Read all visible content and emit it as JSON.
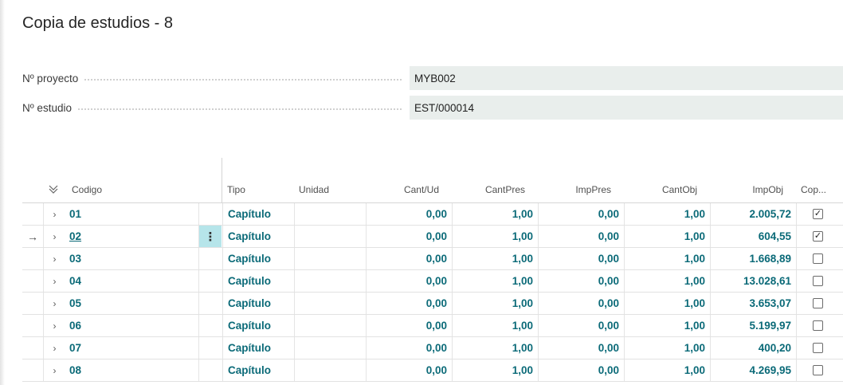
{
  "page": {
    "title": "Copia de estudios - 8"
  },
  "fields": [
    {
      "label": "Nº proyecto",
      "value": "MYB002"
    },
    {
      "label": "Nº estudio",
      "value": "EST/000014"
    }
  ],
  "grid": {
    "columns": {
      "codigo": "Codigo",
      "tipo": "Tipo",
      "unidad": "Unidad",
      "cant_ud": "Cant/Ud",
      "cant_pres": "CantPres",
      "imp_pres": "ImpPres",
      "cant_obj": "CantObj",
      "imp_obj": "ImpObj",
      "copiar": "Cop..."
    },
    "rows": [
      {
        "codigo": "01",
        "tipo": "Capítulo",
        "unidad": "",
        "cant_ud": "0,00",
        "cant_pres": "1,00",
        "imp_pres": "0,00",
        "cant_obj": "1,00",
        "imp_obj": "2.005,72",
        "copiar": true
      },
      {
        "codigo": "02",
        "tipo": "Capítulo",
        "unidad": "",
        "cant_ud": "0,00",
        "cant_pres": "1,00",
        "imp_pres": "0,00",
        "cant_obj": "1,00",
        "imp_obj": "604,55",
        "copiar": true,
        "selected": true
      },
      {
        "codigo": "03",
        "tipo": "Capítulo",
        "unidad": "",
        "cant_ud": "0,00",
        "cant_pres": "1,00",
        "imp_pres": "0,00",
        "cant_obj": "1,00",
        "imp_obj": "1.668,89",
        "copiar": false
      },
      {
        "codigo": "04",
        "tipo": "Capítulo",
        "unidad": "",
        "cant_ud": "0,00",
        "cant_pres": "1,00",
        "imp_pres": "0,00",
        "cant_obj": "1,00",
        "imp_obj": "13.028,61",
        "copiar": false
      },
      {
        "codigo": "05",
        "tipo": "Capítulo",
        "unidad": "",
        "cant_ud": "0,00",
        "cant_pres": "1,00",
        "imp_pres": "0,00",
        "cant_obj": "1,00",
        "imp_obj": "3.653,07",
        "copiar": false
      },
      {
        "codigo": "06",
        "tipo": "Capítulo",
        "unidad": "",
        "cant_ud": "0,00",
        "cant_pres": "1,00",
        "imp_pres": "0,00",
        "cant_obj": "1,00",
        "imp_obj": "5.199,97",
        "copiar": false
      },
      {
        "codigo": "07",
        "tipo": "Capítulo",
        "unidad": "",
        "cant_ud": "0,00",
        "cant_pres": "1,00",
        "imp_pres": "0,00",
        "cant_obj": "1,00",
        "imp_obj": "400,20",
        "copiar": false
      },
      {
        "codigo": "08",
        "tipo": "Capítulo",
        "unidad": "",
        "cant_ud": "0,00",
        "cant_pres": "1,00",
        "imp_pres": "0,00",
        "cant_obj": "1,00",
        "imp_obj": "4.269,95",
        "copiar": false
      }
    ]
  },
  "icons": {
    "collapse_all": "chevron-down-double-icon",
    "expand_row": "chevron-right-icon",
    "current_row": "arrow-right-icon",
    "row_menu": "more-vertical-icon",
    "check": "checkmark-icon"
  },
  "colors": {
    "accent_text": "#0b6a78",
    "field_background": "#e9eeec",
    "menu_highlight": "#b6e5ea"
  }
}
